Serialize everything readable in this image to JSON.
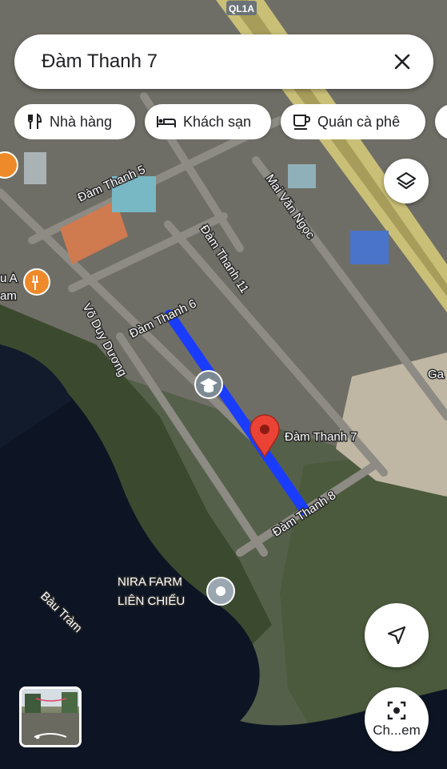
{
  "search": {
    "query": "Đàm Thanh 7"
  },
  "chips": [
    {
      "label": "Nhà hàng",
      "icon": "restaurant-icon"
    },
    {
      "label": "Khách sạn",
      "icon": "hotel-icon"
    },
    {
      "label": "Quán cà phê",
      "icon": "coffee-icon"
    }
  ],
  "map": {
    "highway_label": "QL1A",
    "road_labels": {
      "dam_thanh_5": "Đàm Thanh 5",
      "dam_thanh_6": "Đàm Thanh 6",
      "dam_thanh_11": "Đàm Thanh 11",
      "dam_thanh_8": "Đàm Thanh 8",
      "mai_van_ngoc": "Mai Văn Ngọc",
      "vo_duy_duong": "Võ Duy Dương"
    },
    "pin_label": "Đàm Thanh 7",
    "poi_nira_line1": "NIRA FARM",
    "poi_nira_line2": "LIÊN CHIỂU",
    "lake_label": "Bàu Tràm",
    "edge_label_a": "u A",
    "edge_label_am": "am",
    "edge_label_ga": "Ga",
    "colors": {
      "route": "#1a3cff",
      "pin": "#ea4335",
      "water": "#0d1524",
      "vegetation": "#3b4a2e"
    }
  },
  "controls": {
    "street_view_label": "Ch...em"
  }
}
